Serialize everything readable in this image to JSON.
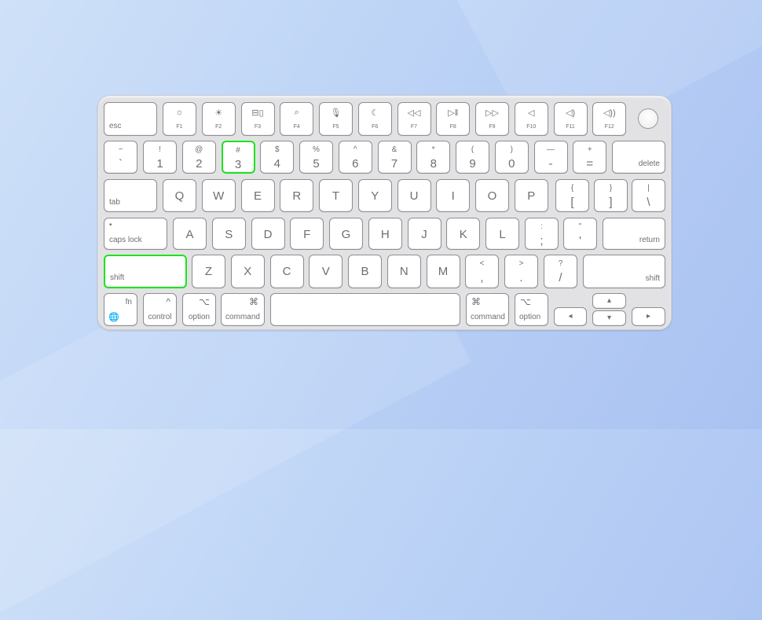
{
  "colors": {
    "highlight": "#1fe21f",
    "background": "#bcd3f6",
    "key": "#ffffff",
    "body": "#e2e2e4"
  },
  "highlighted_keys": [
    "3",
    "left-shift"
  ],
  "rows": {
    "function": [
      {
        "label": "esc"
      },
      {
        "label": "F1",
        "icon": "brightness-low-icon",
        "glyph": "☼"
      },
      {
        "label": "F2",
        "icon": "brightness-high-icon",
        "glyph": "☀"
      },
      {
        "label": "F3",
        "icon": "mission-control-icon",
        "glyph": "⊟▯"
      },
      {
        "label": "F4",
        "icon": "search-icon",
        "glyph": "⌕"
      },
      {
        "label": "F5",
        "icon": "microphone-icon",
        "glyph": "🎙"
      },
      {
        "label": "F6",
        "icon": "moon-icon",
        "glyph": "☾"
      },
      {
        "label": "F7",
        "icon": "rewind-icon",
        "glyph": "◁◁"
      },
      {
        "label": "F8",
        "icon": "play-pause-icon",
        "glyph": "▷‖"
      },
      {
        "label": "F9",
        "icon": "fast-forward-icon",
        "glyph": "▷▷"
      },
      {
        "label": "F10",
        "icon": "mute-icon",
        "glyph": "◁"
      },
      {
        "label": "F11",
        "icon": "volume-down-icon",
        "glyph": "◁)"
      },
      {
        "label": "F12",
        "icon": "volume-up-icon",
        "glyph": "◁))"
      },
      {
        "label": "",
        "icon": "touch-id-icon"
      }
    ],
    "number": [
      {
        "top": "~",
        "label": "`"
      },
      {
        "top": "!",
        "label": "1"
      },
      {
        "top": "@",
        "label": "2"
      },
      {
        "top": "#",
        "label": "3"
      },
      {
        "top": "$",
        "label": "4"
      },
      {
        "top": "%",
        "label": "5"
      },
      {
        "top": "^",
        "label": "6"
      },
      {
        "top": "&",
        "label": "7"
      },
      {
        "top": "*",
        "label": "8"
      },
      {
        "top": "(",
        "label": "9"
      },
      {
        "top": ")",
        "label": "0"
      },
      {
        "top": "—",
        "label": "-"
      },
      {
        "top": "+",
        "label": "="
      },
      {
        "label": "delete"
      }
    ],
    "qwerty": [
      {
        "label": "tab"
      },
      {
        "label": "Q"
      },
      {
        "label": "W"
      },
      {
        "label": "E"
      },
      {
        "label": "R"
      },
      {
        "label": "T"
      },
      {
        "label": "Y"
      },
      {
        "label": "U"
      },
      {
        "label": "I"
      },
      {
        "label": "O"
      },
      {
        "label": "P"
      },
      {
        "top": "{",
        "label": "["
      },
      {
        "top": "}",
        "label": "]"
      },
      {
        "top": "|",
        "label": "\\"
      }
    ],
    "home": [
      {
        "top": "•",
        "label": "caps lock"
      },
      {
        "label": "A"
      },
      {
        "label": "S"
      },
      {
        "label": "D"
      },
      {
        "label": "F"
      },
      {
        "label": "G"
      },
      {
        "label": "H"
      },
      {
        "label": "J"
      },
      {
        "label": "K"
      },
      {
        "label": "L"
      },
      {
        "top": ":",
        "label": ";"
      },
      {
        "top": "\"",
        "label": "'"
      },
      {
        "label": "return"
      }
    ],
    "shift": [
      {
        "label": "shift"
      },
      {
        "label": "Z"
      },
      {
        "label": "X"
      },
      {
        "label": "C"
      },
      {
        "label": "V"
      },
      {
        "label": "B"
      },
      {
        "label": "N"
      },
      {
        "label": "M"
      },
      {
        "top": "<",
        "label": ","
      },
      {
        "top": ">",
        "label": "."
      },
      {
        "top": "?",
        "label": "/"
      },
      {
        "label": "shift"
      }
    ],
    "bottom": [
      {
        "top": "fn",
        "label": "🌐",
        "icon": "globe-icon"
      },
      {
        "top": "^",
        "label": "control"
      },
      {
        "top": "⌥",
        "label": "option"
      },
      {
        "top": "⌘",
        "label": "command"
      },
      {
        "label": ""
      },
      {
        "top": "⌘",
        "label": "command"
      },
      {
        "top": "⌥",
        "label": "option"
      },
      {
        "label": "◂",
        "icon": "arrow-left-icon"
      },
      {
        "label": "▴",
        "icon": "arrow-up-icon"
      },
      {
        "label": "▾",
        "icon": "arrow-down-icon"
      },
      {
        "label": "▸",
        "icon": "arrow-right-icon"
      }
    ]
  }
}
